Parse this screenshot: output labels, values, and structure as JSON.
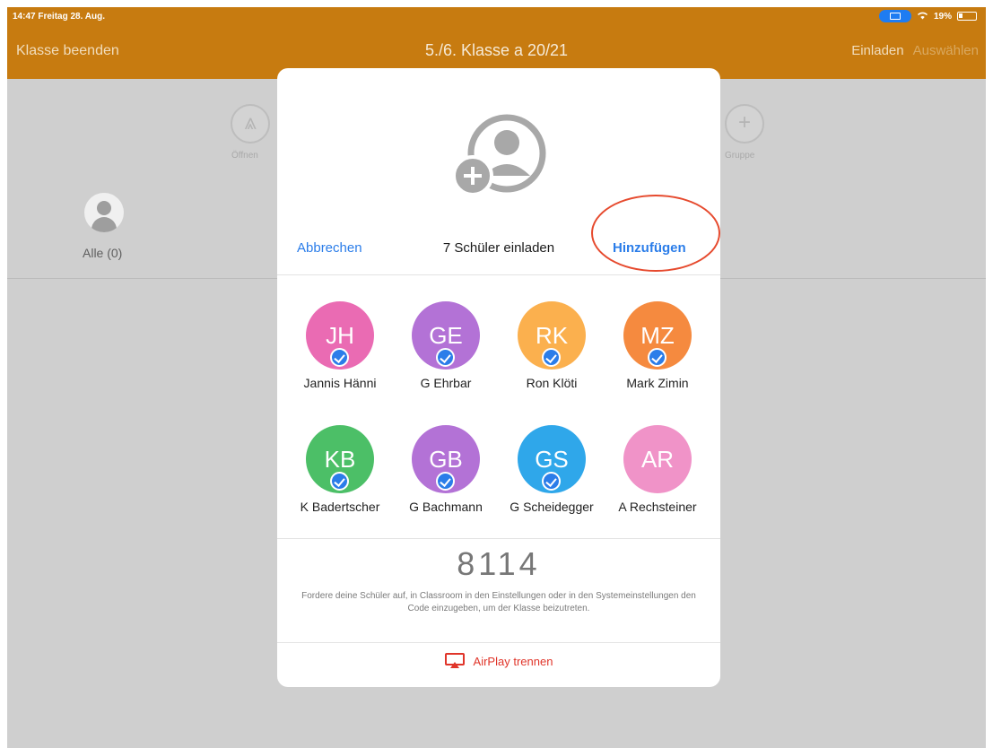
{
  "status_bar": {
    "time_date": "14:47  Freitag 28. Aug.",
    "battery": "19%"
  },
  "nav": {
    "left": "Klasse beenden",
    "title": "5./6. Klasse a 20/21",
    "invite": "Einladen",
    "select": "Auswählen"
  },
  "background": {
    "open_label": "Öffnen",
    "group_label": "Gruppe",
    "all_label": "Alle (0)"
  },
  "popover": {
    "cancel": "Abbrechen",
    "title": "7 Schüler einladen",
    "add": "Hinzufügen",
    "students": [
      {
        "initials": "JH",
        "name": "Jannis Hänni",
        "color": "#ea6bb3",
        "checked": true
      },
      {
        "initials": "GE",
        "name": "G Ehrbar",
        "color": "#b372d6",
        "checked": true
      },
      {
        "initials": "RK",
        "name": "Ron Klöti",
        "color": "#fbb04e",
        "checked": true
      },
      {
        "initials": "MZ",
        "name": "Mark Zimin",
        "color": "#f58a3f",
        "checked": true
      },
      {
        "initials": "KB",
        "name": "K Badertscher",
        "color": "#4cbf67",
        "checked": true
      },
      {
        "initials": "GB",
        "name": "G Bachmann",
        "color": "#b372d6",
        "checked": true
      },
      {
        "initials": "GS",
        "name": "G Scheidegger",
        "color": "#2fa7ea",
        "checked": true
      },
      {
        "initials": "AR",
        "name": "A Rechsteiner",
        "color": "#f093c8",
        "checked": false
      }
    ],
    "code": "8114",
    "instructions": "Fordere deine Schüler auf, in Classroom in den Einstellungen oder in den Systemeinstellungen den Code einzugeben, um der Klasse beizutreten.",
    "airplay": "AirPlay trennen"
  }
}
